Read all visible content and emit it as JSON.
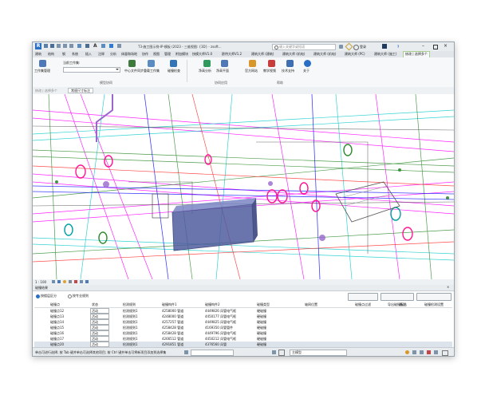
{
  "titlebar": {
    "title": "T3-施工图示例-IP-模板 (2023 - 三维视图: {3D} - zsoft...",
    "search_placeholder": "键入关键字或短语",
    "user": "登录",
    "help": "?"
  },
  "ribbon_tabs": [
    "建筑",
    "结构",
    "钢",
    "系统",
    "插入",
    "注释",
    "分析",
    "体量和场地",
    "协作",
    "视图",
    "管理",
    "附加模块",
    "快模大师V1.0",
    "欧特大师V1.2",
    "建筑大师 (建筑)",
    "建筑大师 (机电)",
    "建筑大师 (机电)",
    "建筑大师 (PC)",
    "建筑大师 (施工)",
    "修改 | 选择多个"
  ],
  "ribbon_active_tab": "修改 | 选择多个",
  "ribbon": {
    "workset_label": "当前工作集:",
    "workset_manage": "工作集管理",
    "buttons": [
      "中心文件同步",
      "重载工作集",
      "碰撞检查",
      "净高分析",
      "净高平面",
      "官方网站",
      "教学视频",
      "技术支持",
      "关于"
    ],
    "groups": [
      "模型协同",
      "协同应用",
      "帮助"
    ]
  },
  "qbar": {
    "tab1": "修改 | 选择多个",
    "tab2": "常规尺寸标注"
  },
  "view_status": {
    "scale": "1 : 100"
  },
  "panel": {
    "title": "碰撞结果",
    "radio_group": "按楼层区分",
    "radio_category": "按专业规则",
    "btn_filter": "碰撞点过滤",
    "btn_export": "导出碰撞报告",
    "btn_settings": "碰撞检测设置",
    "columns": [
      "碰撞点",
      "状态",
      "检测规则",
      "碰撞构件1",
      "碰撞构件2",
      "碰撞类型",
      "轴网位置",
      "备注"
    ],
    "rows": [
      {
        "name": "碰撞点12",
        "status": "活动",
        "rule": "检测规则1",
        "e1": "4258000 管道",
        "e2": "4449826 风管电气框",
        "type": "硬碰撞"
      },
      {
        "name": "碰撞点13",
        "status": "活动",
        "rule": "检测规则1",
        "e1": "4248000 管道",
        "e2": "4450177 风管电气框",
        "type": "硬碰撞"
      },
      {
        "name": "碰撞点14",
        "status": "活动",
        "rule": "检测规则1",
        "e1": "4257257 管道",
        "e2": "4449825 风管电气框",
        "type": "硬碰撞"
      },
      {
        "name": "碰撞点15",
        "status": "活动",
        "rule": "检测规则1",
        "e1": "4258428 管道",
        "e2": "4169350 风管管件",
        "type": "硬碰撞"
      },
      {
        "name": "碰撞点16",
        "status": "活动",
        "rule": "检测规则1",
        "e1": "4258428 管道",
        "e2": "4449796 风管电气框",
        "type": "硬碰撞"
      },
      {
        "name": "碰撞点17",
        "status": "活动",
        "rule": "检测规则1",
        "e1": "4266512 管道",
        "e2": "4450212 风管电气框",
        "type": "硬碰撞"
      },
      {
        "name": "碰撞点20",
        "status": "活动",
        "rule": "检测规则1",
        "e1": "4291851 管道",
        "e2": "4376560 风管",
        "type": "硬碰撞"
      },
      {
        "name": "碰撞点21",
        "status": "活动",
        "rule": "检测规则1",
        "e1": "4291851 管道",
        "e2": "4450038 风管电气框",
        "type": "硬碰撞"
      }
    ]
  },
  "statusbar": {
    "hint": "单击可进行选择; 按 Tab 键并单击可选择其他项目; 按 Ctrl 键并单击可将新项目添加到选择集",
    "model": "主模型"
  }
}
